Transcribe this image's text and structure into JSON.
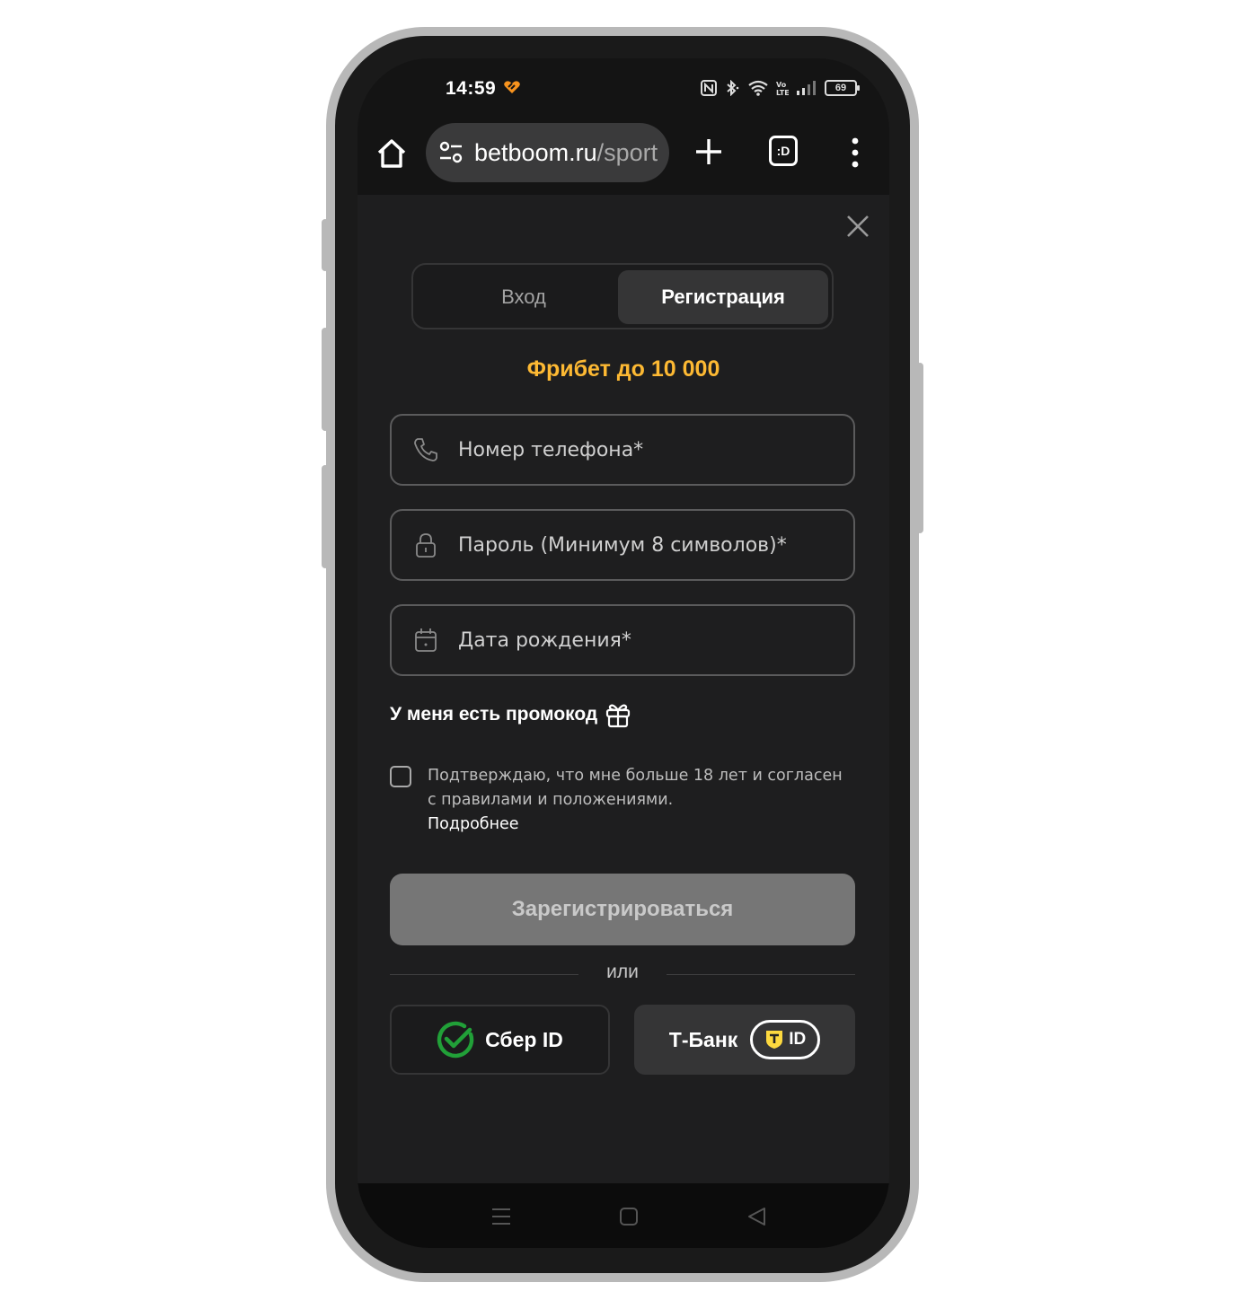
{
  "status_bar": {
    "time": "14:59",
    "battery": "69"
  },
  "browser": {
    "url_domain": "betboom.ru",
    "url_path": "/sport"
  },
  "auth": {
    "tab_login": "Вход",
    "tab_register": "Регистрация",
    "active_tab": "register",
    "promo_banner": "Фрибет до 10 000",
    "fields": {
      "phone_placeholder": "Номер телефона*",
      "password_placeholder": "Пароль (Минимум 8 символов)*",
      "birthdate_placeholder": "Дата рождения*"
    },
    "promo_code_link": "У меня есть промокод",
    "agree_text": "Подтверждаю, что мне больше 18 лет и согласен с правилами и положениями.",
    "agree_more": "Подробнее",
    "agree_checked": false,
    "register_button": "Зарегистрироваться",
    "divider_or": "или",
    "sber_button": "Сбер ID",
    "tbank_button": "Т-Банк",
    "tbank_id_badge": "ID"
  },
  "colors": {
    "accent_yellow": "#fdb933",
    "sber_green": "#21a038",
    "background": "#1e1e1f"
  },
  "icons": [
    "home-icon",
    "site-settings-icon",
    "plus-icon",
    "tab-switcher-icon",
    "kebab-menu-icon",
    "close-icon",
    "phone-icon",
    "lock-icon",
    "calendar-icon",
    "gift-icon",
    "sber-logo-icon",
    "tbank-shield-icon",
    "nav-recents-icon",
    "nav-home-icon",
    "nav-back-icon"
  ]
}
